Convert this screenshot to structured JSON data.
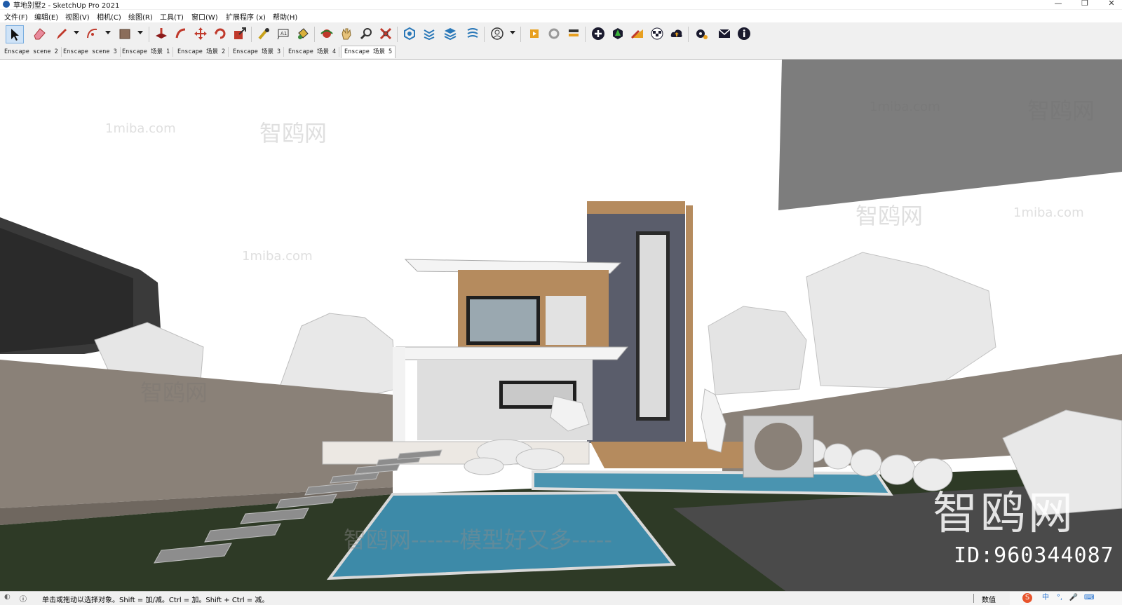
{
  "window": {
    "title": "草地别墅2 - SketchUp Pro 2021",
    "controls": {
      "minimize": "—",
      "restore": "❐",
      "close": "✕"
    }
  },
  "menu": [
    "文件(F)",
    "编辑(E)",
    "视图(V)",
    "相机(C)",
    "绘图(R)",
    "工具(T)",
    "窗口(W)",
    "扩展程序 (x)",
    "帮助(H)"
  ],
  "toolbar_icons": [
    "select-icon",
    "eraser-icon",
    "pencil-line-icon",
    "arc-icon",
    "rectangle-icon",
    "push-pull-icon",
    "follow-me-icon",
    "move-icon",
    "rotate-icon",
    "scale-icon",
    "tape-measure-icon",
    "text-icon",
    "paint-bucket-icon",
    "orbit-icon",
    "pan-icon",
    "zoom-icon",
    "zoom-extents-icon",
    "components-icon",
    "materials-icon",
    "layers-icon",
    "styles-icon",
    "user-account-icon",
    "enscape-start-icon",
    "enscape-sync-icon",
    "enscape-views-icon",
    "add-icon",
    "tree-icon",
    "material-palette-icon",
    "checker-icon",
    "cloud-upload-icon",
    "settings-icon",
    "mail-icon",
    "info-icon"
  ],
  "tabs": [
    "Enscape scene 2",
    "Enscape scene 3",
    "Enscape 场景 1",
    "Enscape 场景 2",
    "Enscape 场景 3",
    "Enscape 场景 4",
    "Enscape 场景 5"
  ],
  "active_tab": 6,
  "viewport": {
    "watermarks": [
      "1miba.com",
      "智鸥网",
      "1miba.com",
      "智鸥网",
      "1miba.com",
      "智鸥网",
      "1miba.com",
      "智鸥网",
      "智鸥网------模型好又多-----"
    ],
    "brand": "智鸥网",
    "model_id": "ID:960344087"
  },
  "status": {
    "message": "单击或拖动以选择对象。Shift = 加/减。Ctrl = 加。Shift + Ctrl = 减。",
    "measurements_label": "数值",
    "ime_indicators": [
      "中",
      "°,",
      "🎤",
      "⌨"
    ]
  },
  "colors": {
    "toolbar_bg": "#f0f0f0",
    "accent_blue": "#1e5aa8",
    "wall": "#8a8178",
    "water": "#3d8aa8",
    "grass": "#2e3a26"
  }
}
